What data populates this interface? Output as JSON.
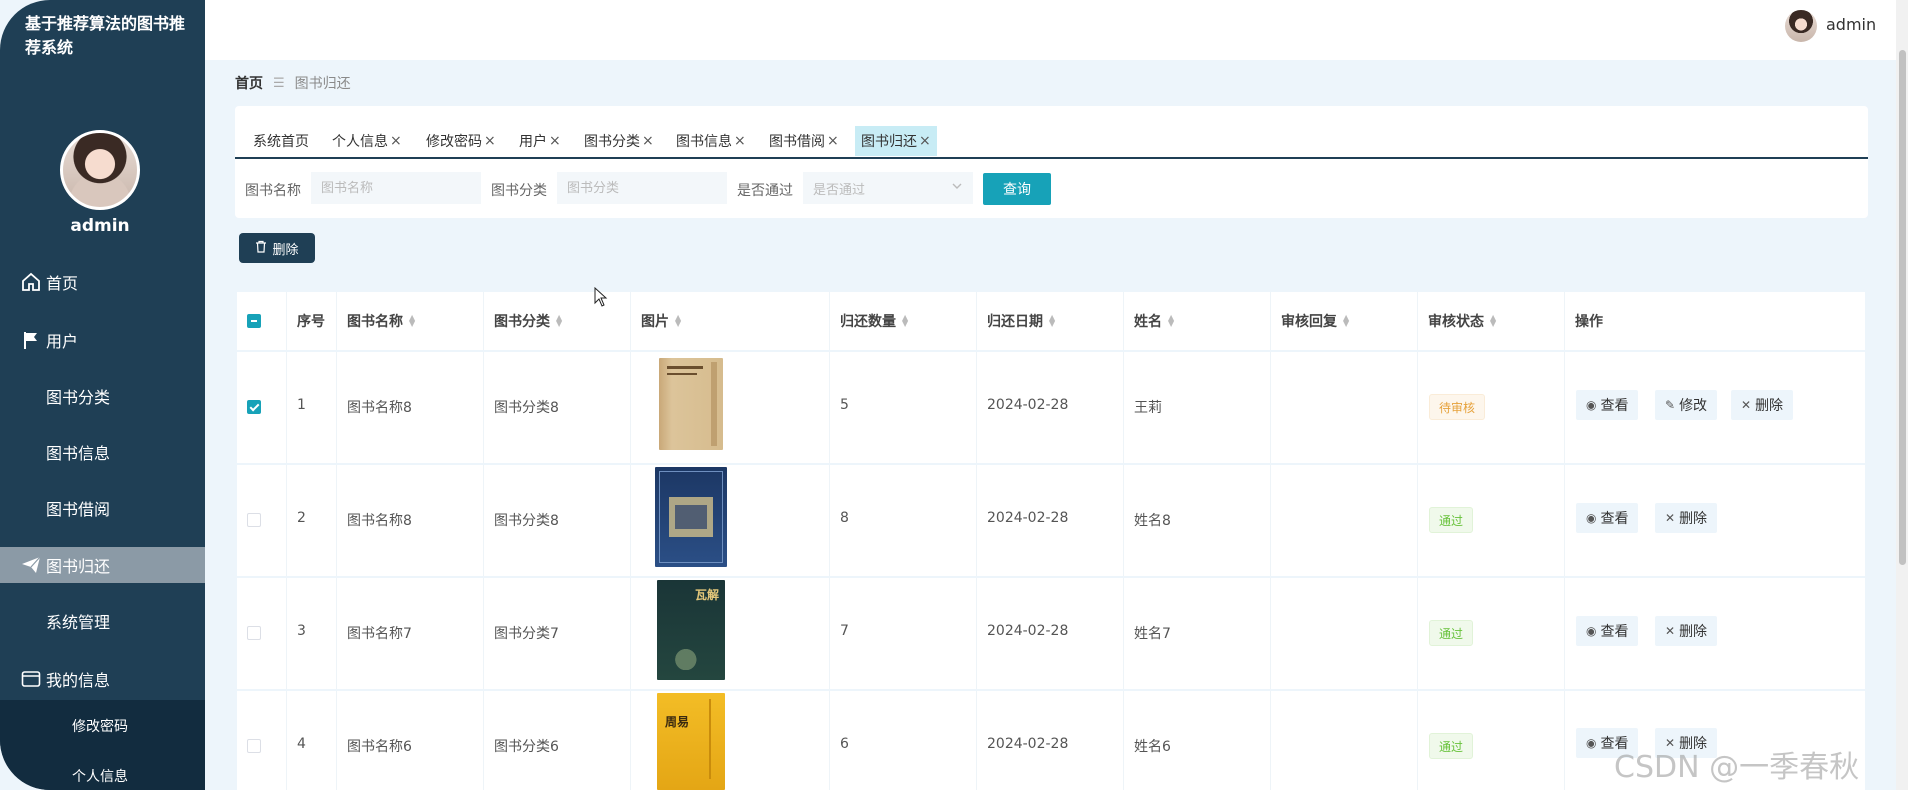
{
  "app": {
    "title": "基于推荐算法的图书推荐系统"
  },
  "user": {
    "name": "admin"
  },
  "sidebar": {
    "items": [
      {
        "label": "首页",
        "icon": "home-icon"
      },
      {
        "label": "用户",
        "icon": "flag-icon"
      },
      {
        "label": "图书分类",
        "icon": "grid-icon"
      },
      {
        "label": "图书信息",
        "icon": "grid-icon"
      },
      {
        "label": "图书借阅",
        "icon": "grid-icon"
      },
      {
        "label": "图书归还",
        "icon": "paper-plane-icon",
        "active": true
      },
      {
        "label": "系统管理",
        "icon": "grid-icon"
      },
      {
        "label": "我的信息",
        "icon": "card-icon"
      }
    ],
    "submenu": [
      "修改密码",
      "个人信息"
    ]
  },
  "breadcrumb": {
    "home": "首页",
    "separator": "☰",
    "current": "图书归还"
  },
  "tabs": [
    {
      "label": "系统首页",
      "closable": false
    },
    {
      "label": "个人信息",
      "closable": true
    },
    {
      "label": "修改密码",
      "closable": true
    },
    {
      "label": "用户",
      "closable": true
    },
    {
      "label": "图书分类",
      "closable": true
    },
    {
      "label": "图书信息",
      "closable": true
    },
    {
      "label": "图书借阅",
      "closable": true
    },
    {
      "label": "图书归还",
      "closable": true,
      "active": true
    }
  ],
  "search": {
    "book_name_label": "图书名称",
    "book_name_placeholder": "图书名称",
    "category_label": "图书分类",
    "category_placeholder": "图书分类",
    "approved_label": "是否通过",
    "approved_placeholder": "是否通过",
    "query_button": "查询"
  },
  "toolbar": {
    "delete_button": "删除"
  },
  "table": {
    "headers": [
      "序号",
      "图书名称",
      "图书分类",
      "图片",
      "归还数量",
      "归还日期",
      "姓名",
      "审核回复",
      "审核状态",
      "操作"
    ],
    "rows": [
      {
        "index": "1",
        "name": "图书名称8",
        "category": "图书分类8",
        "quantity": "5",
        "date": "2024-02-28",
        "person": "王莉",
        "reply": "",
        "status": "待审核",
        "status_kind": "pending",
        "checked": true,
        "actions": [
          "查看",
          "修改",
          "删除"
        ]
      },
      {
        "index": "2",
        "name": "图书名称8",
        "category": "图书分类8",
        "quantity": "8",
        "date": "2024-02-28",
        "person": "姓名8",
        "reply": "",
        "status": "通过",
        "status_kind": "pass",
        "checked": false,
        "actions": [
          "查看",
          "删除"
        ]
      },
      {
        "index": "3",
        "name": "图书名称7",
        "category": "图书分类7",
        "quantity": "7",
        "date": "2024-02-28",
        "person": "姓名7",
        "reply": "",
        "status": "通过",
        "status_kind": "pass",
        "checked": false,
        "actions": [
          "查看",
          "删除"
        ]
      },
      {
        "index": "4",
        "name": "图书名称6",
        "category": "图书分类6",
        "quantity": "6",
        "date": "2024-02-28",
        "person": "姓名6",
        "reply": "",
        "status": "通过",
        "status_kind": "pass",
        "checked": false,
        "actions": [
          "查看",
          "删除"
        ]
      }
    ]
  },
  "book_covers": [
    {
      "title": "",
      "colors": [
        "#d8bb8e",
        "#c7a372"
      ]
    },
    {
      "title": "",
      "colors": [
        "#1f3c6b",
        "#2b4f86"
      ]
    },
    {
      "title": "瓦解",
      "colors": [
        "#1c3b3c",
        "#2a4a45"
      ]
    },
    {
      "title": "周易",
      "colors": [
        "#f0b51c",
        "#e2a412"
      ]
    }
  ],
  "watermark": "CSDN @一季春秋",
  "colors": {
    "sidebar": "#1f3f55",
    "accent": "#17a2b8",
    "active_nav": "#8b9aa6"
  }
}
